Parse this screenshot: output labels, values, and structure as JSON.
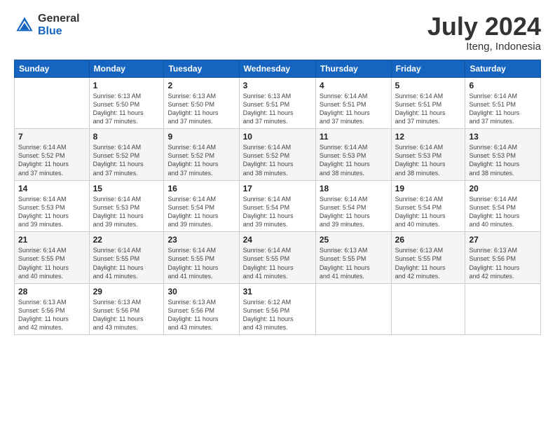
{
  "header": {
    "logo_general": "General",
    "logo_blue": "Blue",
    "title": "July 2024",
    "location": "Iteng, Indonesia"
  },
  "days_of_week": [
    "Sunday",
    "Monday",
    "Tuesday",
    "Wednesday",
    "Thursday",
    "Friday",
    "Saturday"
  ],
  "weeks": [
    [
      {
        "day": "",
        "info": ""
      },
      {
        "day": "1",
        "info": "Sunrise: 6:13 AM\nSunset: 5:50 PM\nDaylight: 11 hours\nand 37 minutes."
      },
      {
        "day": "2",
        "info": "Sunrise: 6:13 AM\nSunset: 5:50 PM\nDaylight: 11 hours\nand 37 minutes."
      },
      {
        "day": "3",
        "info": "Sunrise: 6:13 AM\nSunset: 5:51 PM\nDaylight: 11 hours\nand 37 minutes."
      },
      {
        "day": "4",
        "info": "Sunrise: 6:14 AM\nSunset: 5:51 PM\nDaylight: 11 hours\nand 37 minutes."
      },
      {
        "day": "5",
        "info": "Sunrise: 6:14 AM\nSunset: 5:51 PM\nDaylight: 11 hours\nand 37 minutes."
      },
      {
        "day": "6",
        "info": "Sunrise: 6:14 AM\nSunset: 5:51 PM\nDaylight: 11 hours\nand 37 minutes."
      }
    ],
    [
      {
        "day": "7",
        "info": "Sunrise: 6:14 AM\nSunset: 5:52 PM\nDaylight: 11 hours\nand 37 minutes."
      },
      {
        "day": "8",
        "info": "Sunrise: 6:14 AM\nSunset: 5:52 PM\nDaylight: 11 hours\nand 37 minutes."
      },
      {
        "day": "9",
        "info": "Sunrise: 6:14 AM\nSunset: 5:52 PM\nDaylight: 11 hours\nand 37 minutes."
      },
      {
        "day": "10",
        "info": "Sunrise: 6:14 AM\nSunset: 5:52 PM\nDaylight: 11 hours\nand 38 minutes."
      },
      {
        "day": "11",
        "info": "Sunrise: 6:14 AM\nSunset: 5:53 PM\nDaylight: 11 hours\nand 38 minutes."
      },
      {
        "day": "12",
        "info": "Sunrise: 6:14 AM\nSunset: 5:53 PM\nDaylight: 11 hours\nand 38 minutes."
      },
      {
        "day": "13",
        "info": "Sunrise: 6:14 AM\nSunset: 5:53 PM\nDaylight: 11 hours\nand 38 minutes."
      }
    ],
    [
      {
        "day": "14",
        "info": "Sunrise: 6:14 AM\nSunset: 5:53 PM\nDaylight: 11 hours\nand 39 minutes."
      },
      {
        "day": "15",
        "info": "Sunrise: 6:14 AM\nSunset: 5:53 PM\nDaylight: 11 hours\nand 39 minutes."
      },
      {
        "day": "16",
        "info": "Sunrise: 6:14 AM\nSunset: 5:54 PM\nDaylight: 11 hours\nand 39 minutes."
      },
      {
        "day": "17",
        "info": "Sunrise: 6:14 AM\nSunset: 5:54 PM\nDaylight: 11 hours\nand 39 minutes."
      },
      {
        "day": "18",
        "info": "Sunrise: 6:14 AM\nSunset: 5:54 PM\nDaylight: 11 hours\nand 39 minutes."
      },
      {
        "day": "19",
        "info": "Sunrise: 6:14 AM\nSunset: 5:54 PM\nDaylight: 11 hours\nand 40 minutes."
      },
      {
        "day": "20",
        "info": "Sunrise: 6:14 AM\nSunset: 5:54 PM\nDaylight: 11 hours\nand 40 minutes."
      }
    ],
    [
      {
        "day": "21",
        "info": "Sunrise: 6:14 AM\nSunset: 5:55 PM\nDaylight: 11 hours\nand 40 minutes."
      },
      {
        "day": "22",
        "info": "Sunrise: 6:14 AM\nSunset: 5:55 PM\nDaylight: 11 hours\nand 41 minutes."
      },
      {
        "day": "23",
        "info": "Sunrise: 6:14 AM\nSunset: 5:55 PM\nDaylight: 11 hours\nand 41 minutes."
      },
      {
        "day": "24",
        "info": "Sunrise: 6:14 AM\nSunset: 5:55 PM\nDaylight: 11 hours\nand 41 minutes."
      },
      {
        "day": "25",
        "info": "Sunrise: 6:13 AM\nSunset: 5:55 PM\nDaylight: 11 hours\nand 41 minutes."
      },
      {
        "day": "26",
        "info": "Sunrise: 6:13 AM\nSunset: 5:55 PM\nDaylight: 11 hours\nand 42 minutes."
      },
      {
        "day": "27",
        "info": "Sunrise: 6:13 AM\nSunset: 5:56 PM\nDaylight: 11 hours\nand 42 minutes."
      }
    ],
    [
      {
        "day": "28",
        "info": "Sunrise: 6:13 AM\nSunset: 5:56 PM\nDaylight: 11 hours\nand 42 minutes."
      },
      {
        "day": "29",
        "info": "Sunrise: 6:13 AM\nSunset: 5:56 PM\nDaylight: 11 hours\nand 43 minutes."
      },
      {
        "day": "30",
        "info": "Sunrise: 6:13 AM\nSunset: 5:56 PM\nDaylight: 11 hours\nand 43 minutes."
      },
      {
        "day": "31",
        "info": "Sunrise: 6:12 AM\nSunset: 5:56 PM\nDaylight: 11 hours\nand 43 minutes."
      },
      {
        "day": "",
        "info": ""
      },
      {
        "day": "",
        "info": ""
      },
      {
        "day": "",
        "info": ""
      }
    ]
  ]
}
